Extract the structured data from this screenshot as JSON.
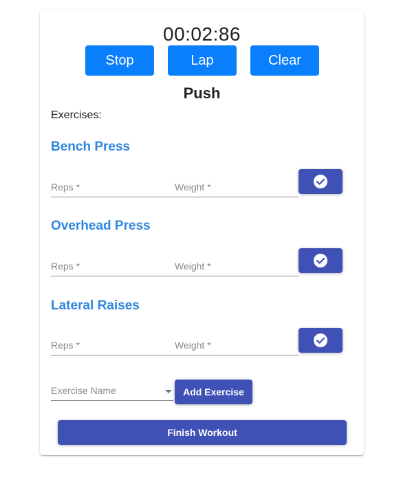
{
  "stopwatch": {
    "time": "00:02:86",
    "stop_label": "Stop",
    "lap_label": "Lap",
    "clear_label": "Clear"
  },
  "workout": {
    "title": "Push",
    "exercises_label": "Exercises:",
    "exercises": [
      {
        "name": "Bench Press",
        "reps_placeholder": "Reps *",
        "weight_placeholder": "Weight *",
        "complete_icon": "check-circle-icon"
      },
      {
        "name": "Overhead Press",
        "reps_placeholder": "Reps *",
        "weight_placeholder": "Weight *",
        "complete_icon": "check-circle-icon"
      },
      {
        "name": "Lateral Raises",
        "reps_placeholder": "Reps *",
        "weight_placeholder": "Weight *",
        "complete_icon": "check-circle-icon"
      }
    ]
  },
  "add_exercise": {
    "select_placeholder": "Exercise Name",
    "button_label": "Add Exercise"
  },
  "finish_label": "Finish Workout",
  "colors": {
    "control_blue": "#0a7ffb",
    "primary_indigo": "#3f51b5",
    "exercise_name_blue": "#2e86de"
  }
}
